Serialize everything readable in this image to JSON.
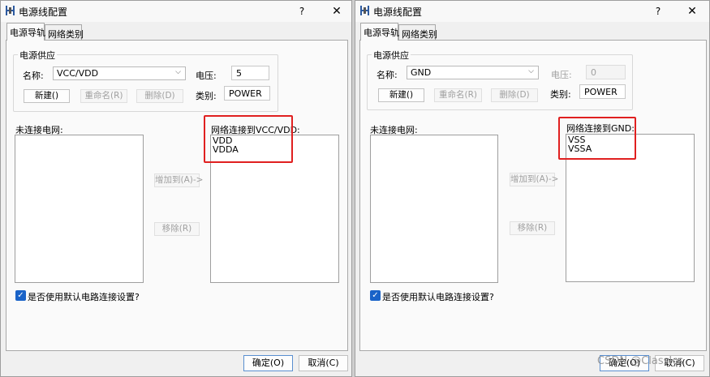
{
  "left_dialog": {
    "title": "电源线配置",
    "help": "?",
    "close": "✕",
    "tabs": [
      "电源导轨",
      "网络类别"
    ],
    "group_title": "电源供应",
    "name_label": "名称:",
    "name_value": "VCC/VDD",
    "voltage_label": "电压:",
    "voltage_value": "5",
    "category_label": "类别:",
    "category_value": "POWER",
    "new_button": "新建()",
    "rename_button": "重命名(R)",
    "delete_button": "删除(D)",
    "unconnected_label": "未连接电网:",
    "connected_label": "网络连接到VCC/VDD:",
    "connected_nets": [
      "VDD",
      "VDDA"
    ],
    "add_button": "增加到(A)->",
    "remove_button": "移除(R)",
    "checkbox_label": "是否使用默认电路连接设置?",
    "ok_button": "确定(O)",
    "cancel_button": "取消(C)"
  },
  "right_dialog": {
    "title": "电源线配置",
    "help": "?",
    "close": "✕",
    "tabs": [
      "电源导轨",
      "网络类别"
    ],
    "group_title": "电源供应",
    "name_label": "名称:",
    "name_value": "GND",
    "voltage_label": "电压:",
    "voltage_value": "0",
    "category_label": "类别:",
    "category_value": "POWER",
    "new_button": "新建()",
    "rename_button": "重命名(R)",
    "delete_button": "删除(D)",
    "unconnected_label": "未连接电网:",
    "connected_label": "网络连接到GND:",
    "connected_nets": [
      "VSS",
      "VSSA"
    ],
    "add_button": "增加到(A)->",
    "remove_button": "移除(R)",
    "checkbox_label": "是否使用默认电路连接设置?",
    "ok_button": "确定(O)",
    "cancel_button": "取消(C)"
  },
  "watermark": "CSDN @ClassIcs"
}
